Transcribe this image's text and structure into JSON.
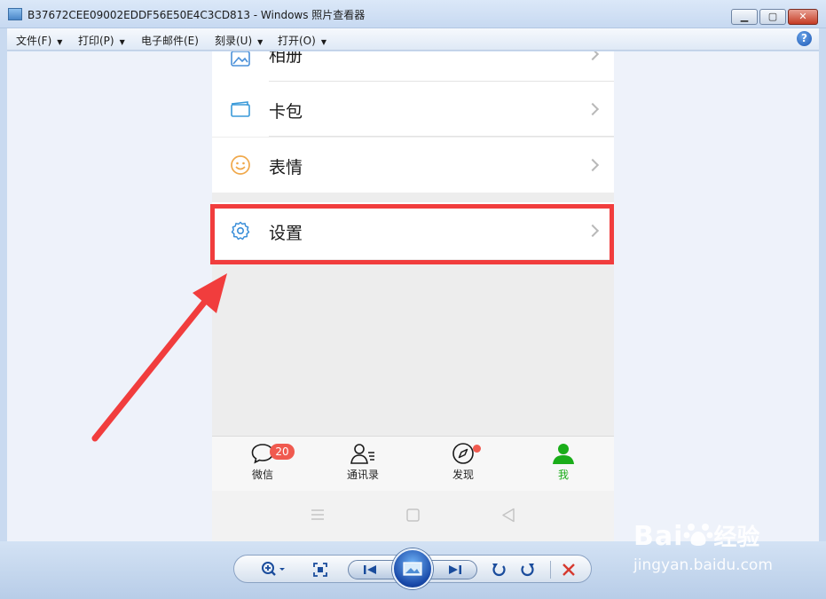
{
  "window": {
    "title": "B37672CEE09002EDDF56E50E4C3CD813 - Windows 照片查看器",
    "minimize_glyph": "▁",
    "maximize_glyph": "▢",
    "close_glyph": "✕"
  },
  "menu": {
    "items": [
      {
        "label": "文件(F)",
        "has_dropdown": true
      },
      {
        "label": "打印(P)",
        "has_dropdown": true
      },
      {
        "label": "电子邮件(E)",
        "has_dropdown": false
      },
      {
        "label": "刻录(U)",
        "has_dropdown": true
      },
      {
        "label": "打开(O)",
        "has_dropdown": true
      }
    ],
    "help_glyph": "?"
  },
  "phone": {
    "rows": [
      {
        "label": "相册",
        "icon": "album-icon"
      },
      {
        "label": "卡包",
        "icon": "card-wallet-icon"
      },
      {
        "label": "表情",
        "icon": "emoji-icon"
      },
      {
        "label": "设置",
        "icon": "gear-icon",
        "highlighted": true
      }
    ],
    "tabs": [
      {
        "label": "微信",
        "icon": "chat-icon",
        "badge": "20"
      },
      {
        "label": "通讯录",
        "icon": "contacts-icon"
      },
      {
        "label": "发现",
        "icon": "compass-icon",
        "dot": true
      },
      {
        "label": "我",
        "icon": "me-icon",
        "active": true
      }
    ],
    "nav_buttons": [
      "menu-icon",
      "home-icon",
      "back-icon"
    ],
    "colors": {
      "active_green": "#1aad19",
      "badge_red": "#f05a4f",
      "highlight_red": "#f13d3d"
    }
  },
  "controls": {
    "buttons": [
      "zoom-icon",
      "actual-size-icon",
      "previous-icon",
      "slideshow-icon",
      "next-icon",
      "rotate-left-icon",
      "rotate-right-icon",
      "delete-icon"
    ]
  },
  "watermark": {
    "brand": "Bai",
    "brand_suffix": "经验",
    "url": "jingyan.baidu.com"
  }
}
